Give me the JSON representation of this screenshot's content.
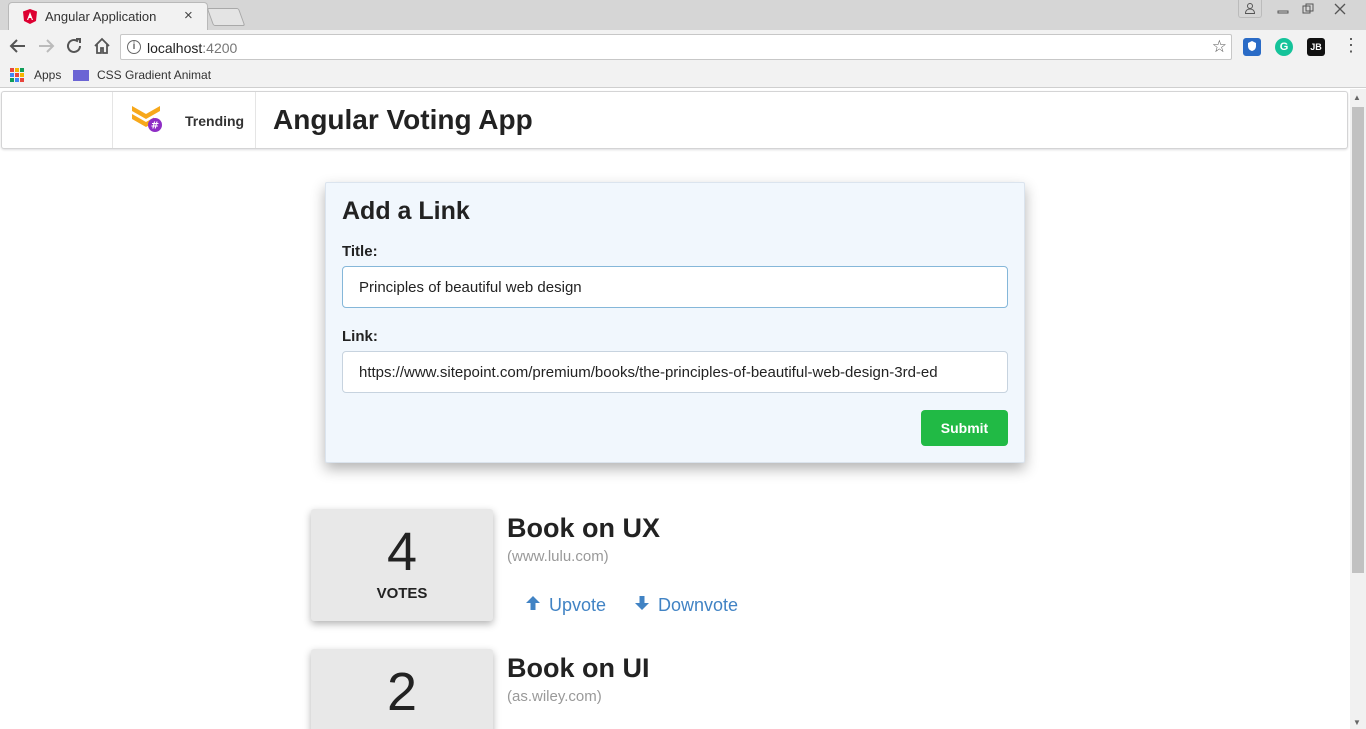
{
  "browser": {
    "tab_title": "Angular Application",
    "tab_close": "×",
    "url_host": "localhost",
    "url_port": ":4200",
    "bookmarks": [
      "Apps",
      "CSS Gradient Animat"
    ],
    "extension_jb": "JB",
    "extension_g": "G"
  },
  "header": {
    "nav_item": "Trending",
    "title": "Angular Voting App"
  },
  "form": {
    "heading": "Add a Link",
    "title_label": "Title:",
    "title_value": "Principles of beautiful web design",
    "link_label": "Link:",
    "link_value": "https://www.sitepoint.com/premium/books/the-principles-of-beautiful-web-design-3rd-ed",
    "submit_label": "Submit"
  },
  "articles": [
    {
      "votes": "4",
      "votes_label": "VOTES",
      "title": "Book on UX",
      "domain": "(www.lulu.com)",
      "upvote": "Upvote",
      "downvote": "Downvote"
    },
    {
      "votes": "2",
      "title": "Book on UI",
      "domain": "(as.wiley.com)"
    }
  ],
  "colors": {
    "accent": "#4183c4",
    "submit": "#21ba45",
    "angular_red": "#dd0031",
    "logo_orange": "#f7a81b",
    "logo_purple": "#8e2dc5"
  }
}
